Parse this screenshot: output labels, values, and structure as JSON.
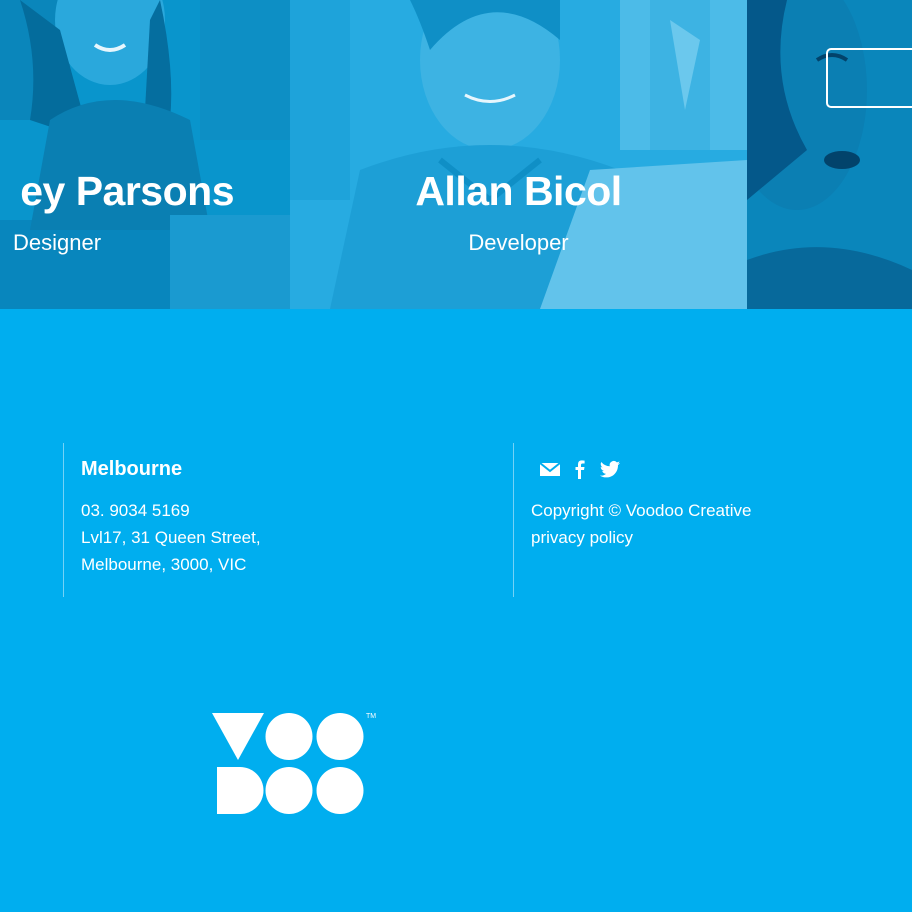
{
  "team": [
    {
      "name": "ey Parsons",
      "role": "Designer"
    },
    {
      "name": "Allan Bicol",
      "role": "Developer"
    },
    {
      "name": "",
      "role": ""
    }
  ],
  "footer": {
    "office": {
      "title": "Melbourne",
      "phone": "03. 9034 5169",
      "address_line1": "Lvl17, 31 Queen Street,",
      "address_line2": "Melbourne, 3000, VIC"
    },
    "social_icons": [
      "mail-icon",
      "facebook-icon",
      "twitter-icon"
    ],
    "copyright": "Copyright © Voodoo Creative",
    "privacy_link": "privacy policy"
  },
  "logo": {
    "text": "VOODOO",
    "trademark": "TM"
  },
  "colors": {
    "brand_blue": "#00aeef",
    "photo_overlay": "#0a9ad3",
    "text": "#ffffff"
  }
}
